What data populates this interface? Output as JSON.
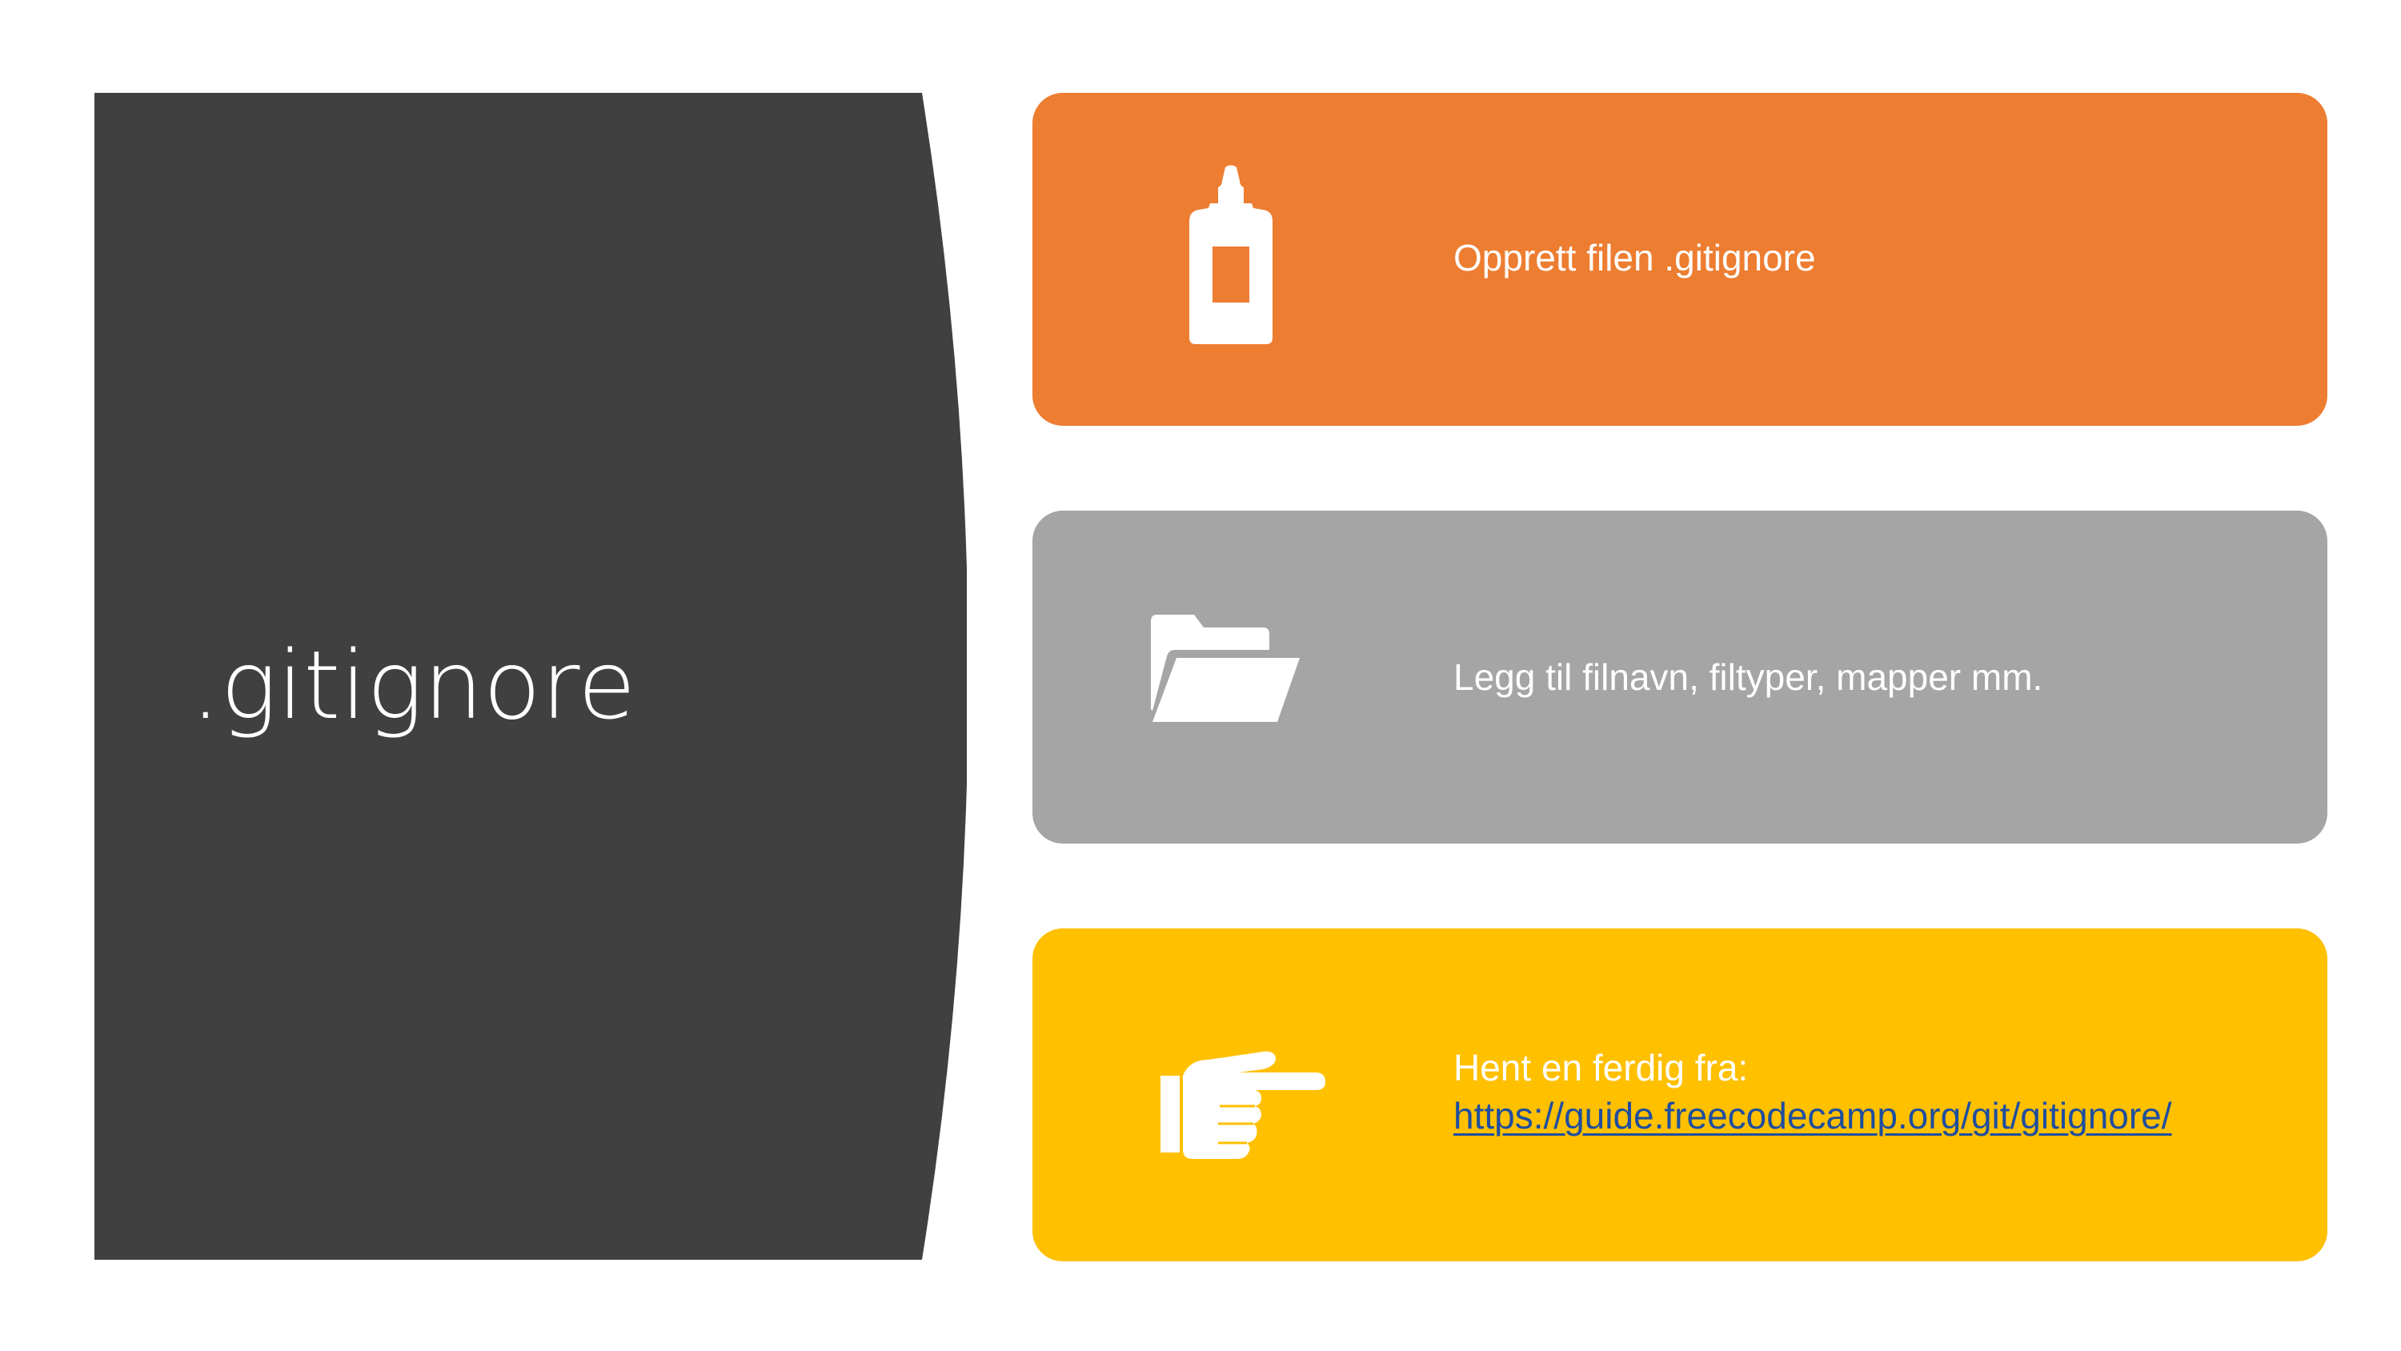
{
  "slide": {
    "title": ".gitignore",
    "panel_color": "#404040"
  },
  "cards": [
    {
      "text": "Opprett filen .gitignore",
      "color": "#ED7D31",
      "icon": "glue-bottle-icon"
    },
    {
      "text": "Legg til filnavn, filtyper, mapper mm.",
      "color": "#A5A5A5",
      "icon": "open-folder-icon"
    },
    {
      "text": "Hent en ferdig fra:",
      "link": "https://guide.freecodecamp.org/git/gitignore/",
      "color": "#FFC000",
      "link_color": "#1F4E9E",
      "icon": "pointing-hand-icon"
    }
  ]
}
